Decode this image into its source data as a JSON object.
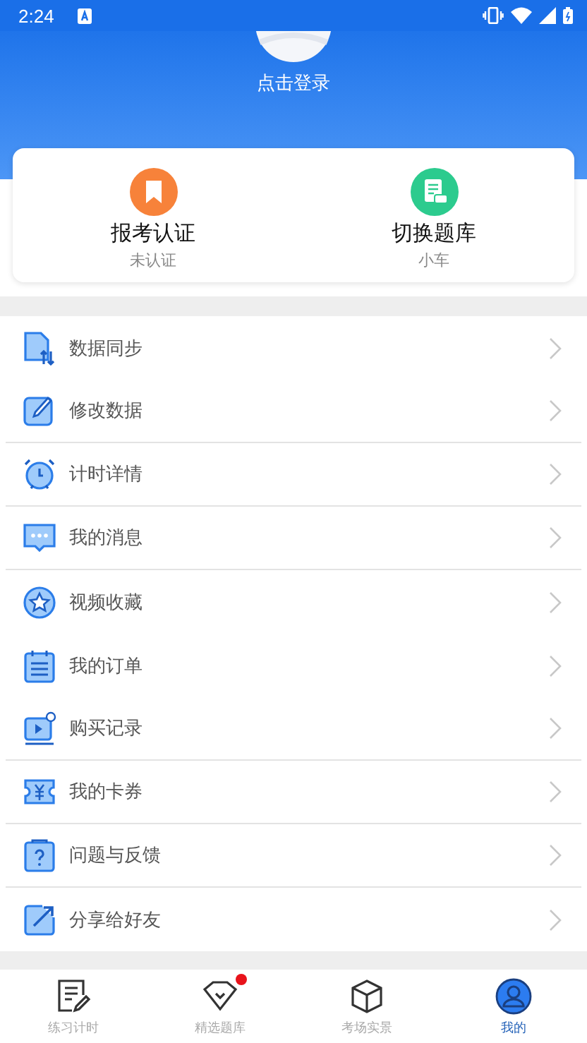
{
  "status_bar": {
    "time": "2:24"
  },
  "profile": {
    "login_text": "点击登录"
  },
  "quick_cards": [
    {
      "kind": "cert",
      "title": "报考认证",
      "subtitle": "未认证",
      "color": "#f7823a"
    },
    {
      "kind": "bank",
      "title": "切换题库",
      "subtitle": "小车",
      "color": "#2ccb8e"
    }
  ],
  "menu": [
    {
      "label": "数据同步",
      "divider_below": false
    },
    {
      "label": "修改数据",
      "divider_below": true
    },
    {
      "label": "计时详情",
      "divider_below": true
    },
    {
      "label": "我的消息",
      "divider_below": true
    },
    {
      "label": "视频收藏",
      "divider_below": false
    },
    {
      "label": "我的订单",
      "divider_below": false
    },
    {
      "label": "购买记录",
      "divider_below": true
    },
    {
      "label": "我的卡券",
      "divider_below": true
    },
    {
      "label": "问题与反馈",
      "divider_below": true
    },
    {
      "label": "分享给好友",
      "divider_below": false
    }
  ],
  "tab_bar": [
    {
      "label": "练习计时",
      "selected": false,
      "badge": false
    },
    {
      "label": "精选题库",
      "selected": false,
      "badge": true
    },
    {
      "label": "考场实景",
      "selected": false,
      "badge": false
    },
    {
      "label": "我的",
      "selected": true,
      "badge": false
    }
  ]
}
